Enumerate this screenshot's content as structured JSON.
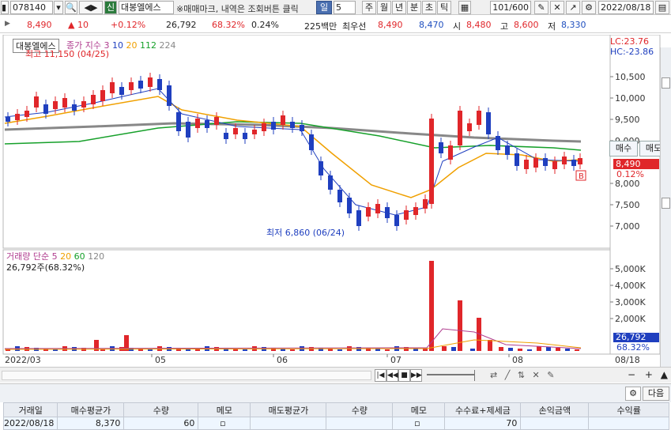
{
  "toolbar": {
    "code": "078140",
    "stock_badge": "신",
    "stock_name": "대봉엘에스",
    "notice": "※매매마크, 내역은 조회버튼 클릭",
    "period_selected": "일",
    "period_count": "5",
    "periods": [
      "주",
      "월",
      "년",
      "분",
      "초",
      "틱"
    ],
    "page": "101",
    "page_total": "/600",
    "date": "2022/08/18"
  },
  "quote": {
    "price": "8,490",
    "change": "10",
    "change_pct": "+0.12%",
    "volume": "26,792",
    "vol_pct": "68.32%",
    "turnover": "0.24%",
    "rank": "225백만",
    "best_label": "최우선",
    "ask": "8,490",
    "bid": "8,470",
    "open_label": "시",
    "open": "8,480",
    "high_label": "고",
    "high": "8,600",
    "low_label": "저",
    "low": "8,330"
  },
  "price_panel": {
    "stock_label": "대봉엘에스",
    "ma_label": "종가 지수 3",
    "ma_periods": [
      {
        "v": "10",
        "color": "#1f3fbf"
      },
      {
        "v": "20",
        "color": "#f0a000"
      },
      {
        "v": "112",
        "color": "#16a02a"
      },
      {
        "v": "224",
        "color": "#888888"
      }
    ],
    "lc": "LC:23.76",
    "hc": "HC:-23.86",
    "high_note": "최고 11,150 (04/25)",
    "low_note": "최저 6,860 (06/24)",
    "price_tag": "8,490",
    "pct_tag": "0.12%",
    "marker": "B",
    "y_ticks": [
      "10,500",
      "10,000",
      "9,500",
      "9,000",
      "8,000",
      "7,500",
      "7,000"
    ],
    "buy_btn": "매수",
    "sell_btn": "매도"
  },
  "volume_panel": {
    "label": "거래량",
    "ma_label": "단순 5",
    "ma_periods": [
      {
        "v": "20",
        "color": "#f0a000"
      },
      {
        "v": "60",
        "color": "#16a02a"
      },
      {
        "v": "120",
        "color": "#888888"
      }
    ],
    "current": "26,792주(68.32%)",
    "tag": "26,792",
    "tag_pct": "68.32%",
    "y_ticks": [
      "5,000K",
      "4,000K",
      "3,000K",
      "2,000K"
    ]
  },
  "x_axis": [
    "2022/03",
    "05",
    "06",
    "07",
    "08",
    "08/18"
  ],
  "bottom": {
    "next_btn": "다음",
    "columns": [
      "거래일",
      "매수평균가",
      "수량",
      "메모",
      "매도평균가",
      "수량",
      "메모",
      "수수료+제세금",
      "손익금액",
      "수익률"
    ],
    "rows": [
      [
        "2022/08/18",
        "8,370",
        "60",
        "",
        "",
        "",
        "",
        "70",
        "",
        ""
      ]
    ]
  }
}
